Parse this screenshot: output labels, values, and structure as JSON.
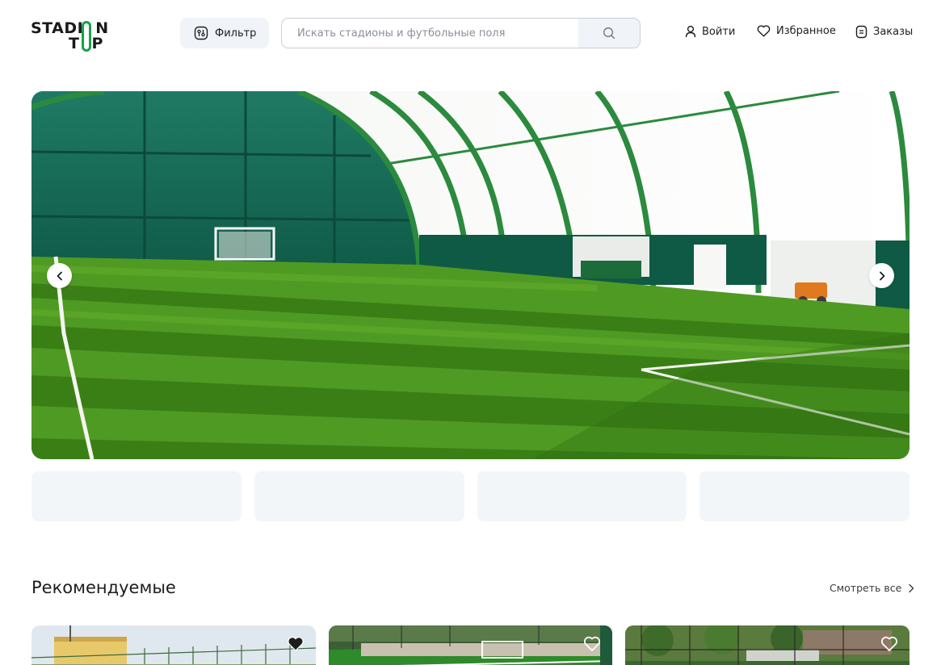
{
  "header": {
    "logo_top": "STADI",
    "logo_top_tail": "N",
    "logo_bottom_t": "T",
    "logo_bottom_p": "P",
    "filter_label": "Фильтр",
    "search_placeholder": "Искать стадионы и футбольные поля",
    "search_value": "",
    "login_label": "Войти",
    "favorites_label": "Избранное",
    "orders_label": "Заказы"
  },
  "hero": {
    "image_description_icon": "stadium-photo",
    "prev_icon": "chevron-left-icon",
    "next_icon": "chevron-right-icon"
  },
  "thumbnails": [
    {
      "id": "thumb-1"
    },
    {
      "id": "thumb-2"
    },
    {
      "id": "thumb-3"
    },
    {
      "id": "thumb-4"
    }
  ],
  "recommended": {
    "title": "Рекомендуемые",
    "see_all_label": "Смотреть все",
    "cards": [
      {
        "favorite": true
      },
      {
        "favorite": false
      },
      {
        "favorite": false
      }
    ]
  },
  "colors": {
    "brand_green": "#17a34a",
    "field_green": "#3f8f1f",
    "surface": "#f0f3f7",
    "border": "#c9ced6"
  }
}
